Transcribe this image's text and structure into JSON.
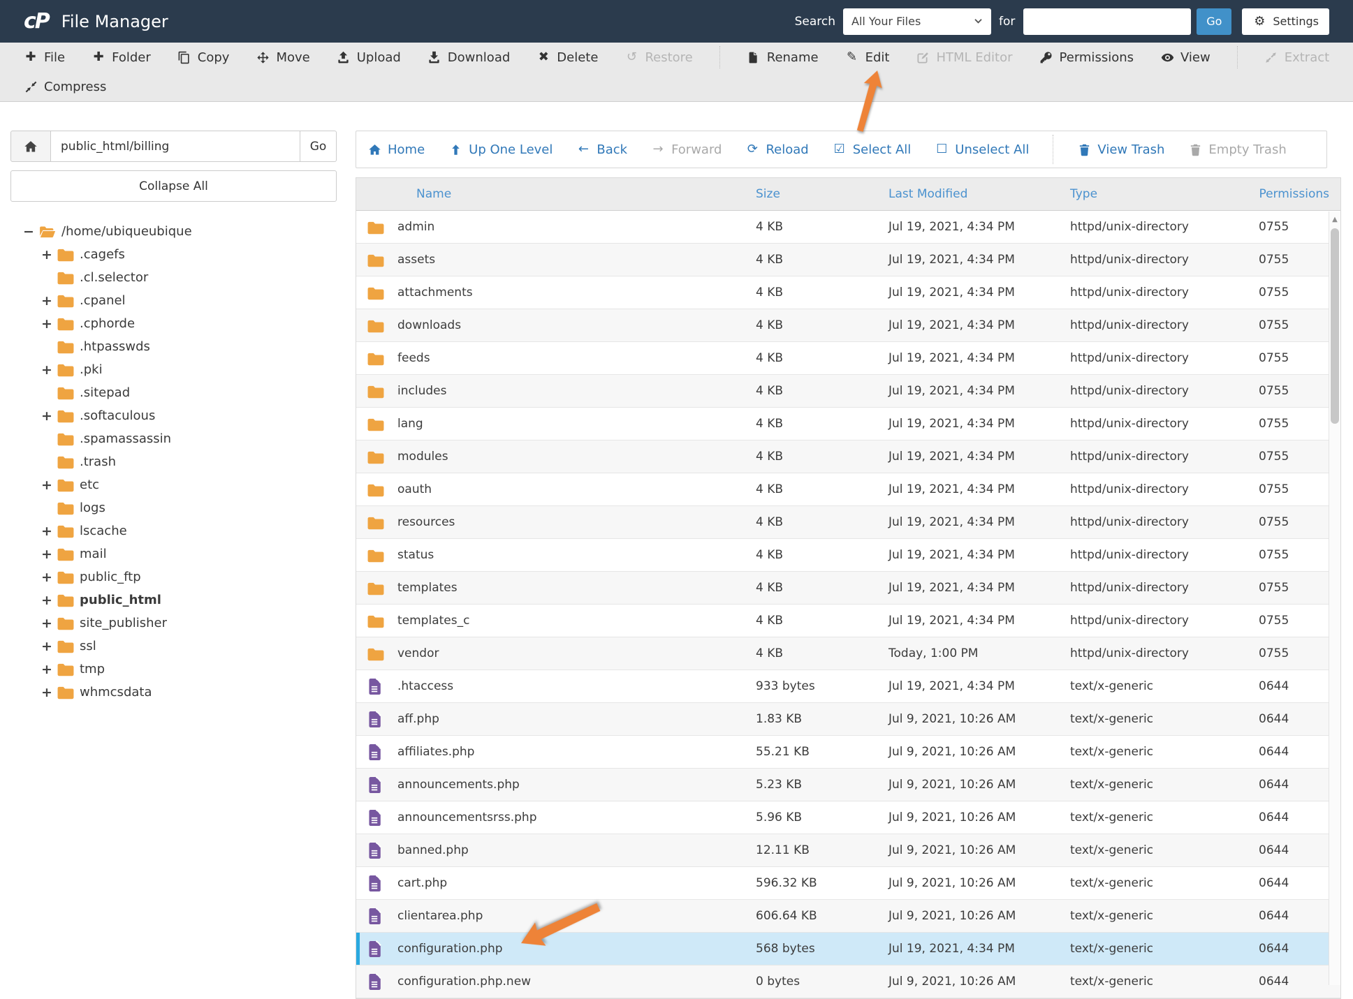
{
  "header": {
    "logo": "cP",
    "title": "File Manager",
    "search_label": "Search",
    "search_scope": "All Your Files",
    "for_label": "for",
    "search_value": "",
    "go": "Go",
    "settings": "Settings"
  },
  "toolbar": {
    "row1": [
      {
        "id": "file",
        "label": "File",
        "icon": "plus",
        "enabled": true
      },
      {
        "id": "folder",
        "label": "Folder",
        "icon": "plus",
        "enabled": true
      },
      {
        "id": "copy",
        "label": "Copy",
        "icon": "copy",
        "enabled": true
      },
      {
        "id": "move",
        "label": "Move",
        "icon": "move",
        "enabled": true
      },
      {
        "id": "upload",
        "label": "Upload",
        "icon": "upload",
        "enabled": true
      },
      {
        "id": "download",
        "label": "Download",
        "icon": "download",
        "enabled": true
      },
      {
        "id": "delete",
        "label": "Delete",
        "icon": "x",
        "enabled": true
      },
      {
        "id": "restore",
        "label": "Restore",
        "icon": "undo",
        "enabled": false
      },
      {
        "divider": true
      },
      {
        "id": "rename",
        "label": "Rename",
        "icon": "doc",
        "enabled": true
      },
      {
        "id": "edit",
        "label": "Edit",
        "icon": "pencil",
        "enabled": true
      },
      {
        "id": "html-editor",
        "label": "HTML Editor",
        "icon": "edit-square",
        "enabled": false
      },
      {
        "id": "permissions",
        "label": "Permissions",
        "icon": "key",
        "enabled": true
      },
      {
        "id": "view",
        "label": "View",
        "icon": "eye",
        "enabled": true
      },
      {
        "divider": true
      },
      {
        "id": "extract",
        "label": "Extract",
        "icon": "expand",
        "enabled": false
      }
    ],
    "row2": [
      {
        "id": "compress",
        "label": "Compress",
        "icon": "compress",
        "enabled": true
      }
    ]
  },
  "sidebar": {
    "path_value": "public_html/billing",
    "go": "Go",
    "collapse_all": "Collapse All",
    "tree": [
      {
        "label": "/home/ubiqueubique",
        "expander": "minus",
        "icon": "folder-open",
        "level": 0
      },
      {
        "label": ".cagefs",
        "expander": "plus",
        "level": 1
      },
      {
        "label": ".cl.selector",
        "expander": "none",
        "level": 1
      },
      {
        "label": ".cpanel",
        "expander": "plus",
        "level": 1
      },
      {
        "label": ".cphorde",
        "expander": "plus",
        "level": 1
      },
      {
        "label": ".htpasswds",
        "expander": "none",
        "level": 1
      },
      {
        "label": ".pki",
        "expander": "plus",
        "level": 1
      },
      {
        "label": ".sitepad",
        "expander": "none",
        "level": 1
      },
      {
        "label": ".softaculous",
        "expander": "plus",
        "level": 1
      },
      {
        "label": ".spamassassin",
        "expander": "none",
        "level": 1
      },
      {
        "label": ".trash",
        "expander": "none",
        "level": 1
      },
      {
        "label": "etc",
        "expander": "plus",
        "level": 1
      },
      {
        "label": "logs",
        "expander": "none",
        "level": 1
      },
      {
        "label": "lscache",
        "expander": "plus",
        "level": 1
      },
      {
        "label": "mail",
        "expander": "plus",
        "level": 1
      },
      {
        "label": "public_ftp",
        "expander": "plus",
        "level": 1
      },
      {
        "label": "public_html",
        "expander": "plus",
        "level": 1,
        "bold": true
      },
      {
        "label": "site_publisher",
        "expander": "plus",
        "level": 1
      },
      {
        "label": "ssl",
        "expander": "plus",
        "level": 1
      },
      {
        "label": "tmp",
        "expander": "plus",
        "level": 1
      },
      {
        "label": "whmcsdata",
        "expander": "plus",
        "level": 1
      }
    ]
  },
  "filenav": [
    {
      "id": "home",
      "label": "Home",
      "icon": "home",
      "enabled": true
    },
    {
      "id": "up-one-level",
      "label": "Up One Level",
      "icon": "up",
      "enabled": true
    },
    {
      "id": "back",
      "label": "Back",
      "icon": "left",
      "enabled": true
    },
    {
      "id": "forward",
      "label": "Forward",
      "icon": "right",
      "enabled": false
    },
    {
      "id": "reload",
      "label": "Reload",
      "icon": "reload",
      "enabled": true
    },
    {
      "id": "select-all",
      "label": "Select All",
      "icon": "check-square",
      "enabled": true
    },
    {
      "id": "unselect-all",
      "label": "Unselect All",
      "icon": "square",
      "enabled": true
    },
    {
      "divider": true
    },
    {
      "id": "view-trash",
      "label": "View Trash",
      "icon": "trash",
      "enabled": true
    },
    {
      "id": "empty-trash",
      "label": "Empty Trash",
      "icon": "trash",
      "enabled": false
    }
  ],
  "table": {
    "columns": [
      "Name",
      "Size",
      "Last Modified",
      "Type",
      "Permissions"
    ],
    "rows": [
      {
        "name": "admin",
        "icon": "folder",
        "size": "4 KB",
        "modified": "Jul 19, 2021, 4:34 PM",
        "type": "httpd/unix-directory",
        "perms": "0755"
      },
      {
        "name": "assets",
        "icon": "folder",
        "size": "4 KB",
        "modified": "Jul 19, 2021, 4:34 PM",
        "type": "httpd/unix-directory",
        "perms": "0755"
      },
      {
        "name": "attachments",
        "icon": "folder",
        "size": "4 KB",
        "modified": "Jul 19, 2021, 4:34 PM",
        "type": "httpd/unix-directory",
        "perms": "0755"
      },
      {
        "name": "downloads",
        "icon": "folder",
        "size": "4 KB",
        "modified": "Jul 19, 2021, 4:34 PM",
        "type": "httpd/unix-directory",
        "perms": "0755"
      },
      {
        "name": "feeds",
        "icon": "folder",
        "size": "4 KB",
        "modified": "Jul 19, 2021, 4:34 PM",
        "type": "httpd/unix-directory",
        "perms": "0755"
      },
      {
        "name": "includes",
        "icon": "folder",
        "size": "4 KB",
        "modified": "Jul 19, 2021, 4:34 PM",
        "type": "httpd/unix-directory",
        "perms": "0755"
      },
      {
        "name": "lang",
        "icon": "folder",
        "size": "4 KB",
        "modified": "Jul 19, 2021, 4:34 PM",
        "type": "httpd/unix-directory",
        "perms": "0755"
      },
      {
        "name": "modules",
        "icon": "folder",
        "size": "4 KB",
        "modified": "Jul 19, 2021, 4:34 PM",
        "type": "httpd/unix-directory",
        "perms": "0755"
      },
      {
        "name": "oauth",
        "icon": "folder",
        "size": "4 KB",
        "modified": "Jul 19, 2021, 4:34 PM",
        "type": "httpd/unix-directory",
        "perms": "0755"
      },
      {
        "name": "resources",
        "icon": "folder",
        "size": "4 KB",
        "modified": "Jul 19, 2021, 4:34 PM",
        "type": "httpd/unix-directory",
        "perms": "0755"
      },
      {
        "name": "status",
        "icon": "folder",
        "size": "4 KB",
        "modified": "Jul 19, 2021, 4:34 PM",
        "type": "httpd/unix-directory",
        "perms": "0755"
      },
      {
        "name": "templates",
        "icon": "folder",
        "size": "4 KB",
        "modified": "Jul 19, 2021, 4:34 PM",
        "type": "httpd/unix-directory",
        "perms": "0755"
      },
      {
        "name": "templates_c",
        "icon": "folder",
        "size": "4 KB",
        "modified": "Jul 19, 2021, 4:34 PM",
        "type": "httpd/unix-directory",
        "perms": "0755"
      },
      {
        "name": "vendor",
        "icon": "folder",
        "size": "4 KB",
        "modified": "Today, 1:00 PM",
        "type": "httpd/unix-directory",
        "perms": "0755"
      },
      {
        "name": ".htaccess",
        "icon": "file",
        "size": "933 bytes",
        "modified": "Jul 19, 2021, 4:34 PM",
        "type": "text/x-generic",
        "perms": "0644"
      },
      {
        "name": "aff.php",
        "icon": "file",
        "size": "1.83 KB",
        "modified": "Jul 9, 2021, 10:26 AM",
        "type": "text/x-generic",
        "perms": "0644"
      },
      {
        "name": "affiliates.php",
        "icon": "file",
        "size": "55.21 KB",
        "modified": "Jul 9, 2021, 10:26 AM",
        "type": "text/x-generic",
        "perms": "0644"
      },
      {
        "name": "announcements.php",
        "icon": "file",
        "size": "5.23 KB",
        "modified": "Jul 9, 2021, 10:26 AM",
        "type": "text/x-generic",
        "perms": "0644"
      },
      {
        "name": "announcementsrss.php",
        "icon": "file",
        "size": "5.96 KB",
        "modified": "Jul 9, 2021, 10:26 AM",
        "type": "text/x-generic",
        "perms": "0644"
      },
      {
        "name": "banned.php",
        "icon": "file",
        "size": "12.11 KB",
        "modified": "Jul 9, 2021, 10:26 AM",
        "type": "text/x-generic",
        "perms": "0644"
      },
      {
        "name": "cart.php",
        "icon": "file",
        "size": "596.32 KB",
        "modified": "Jul 9, 2021, 10:26 AM",
        "type": "text/x-generic",
        "perms": "0644"
      },
      {
        "name": "clientarea.php",
        "icon": "file",
        "size": "606.64 KB",
        "modified": "Jul 9, 2021, 10:26 AM",
        "type": "text/x-generic",
        "perms": "0644"
      },
      {
        "name": "configuration.php",
        "icon": "file",
        "size": "568 bytes",
        "modified": "Jul 19, 2021, 4:34 PM",
        "type": "text/x-generic",
        "perms": "0644",
        "selected": true
      },
      {
        "name": "configuration.php.new",
        "icon": "file",
        "size": "0 bytes",
        "modified": "Jul 9, 2021, 10:26 AM",
        "type": "text/x-generic",
        "perms": "0644"
      }
    ]
  },
  "annotations": {
    "arrows": [
      {
        "id": "edit-arrow",
        "points_to": "Edit toolbar button"
      },
      {
        "id": "configuration-arrow",
        "points_to": "configuration.php row"
      }
    ]
  },
  "colors": {
    "header_bg": "#2b3b4d",
    "toolbar_bg": "#e9e9e9",
    "link_blue": "#3078b8",
    "table_header_blue": "#4b92cf",
    "go_button_blue": "#4191c9",
    "folder_orange": "#efa441",
    "file_purple": "#7757a0",
    "selected_row_bg": "#cfe9f8",
    "selected_row_border": "#2aa9e0",
    "arrow_orange": "#ee8338",
    "disabled_gray": "#b5b5b5"
  }
}
